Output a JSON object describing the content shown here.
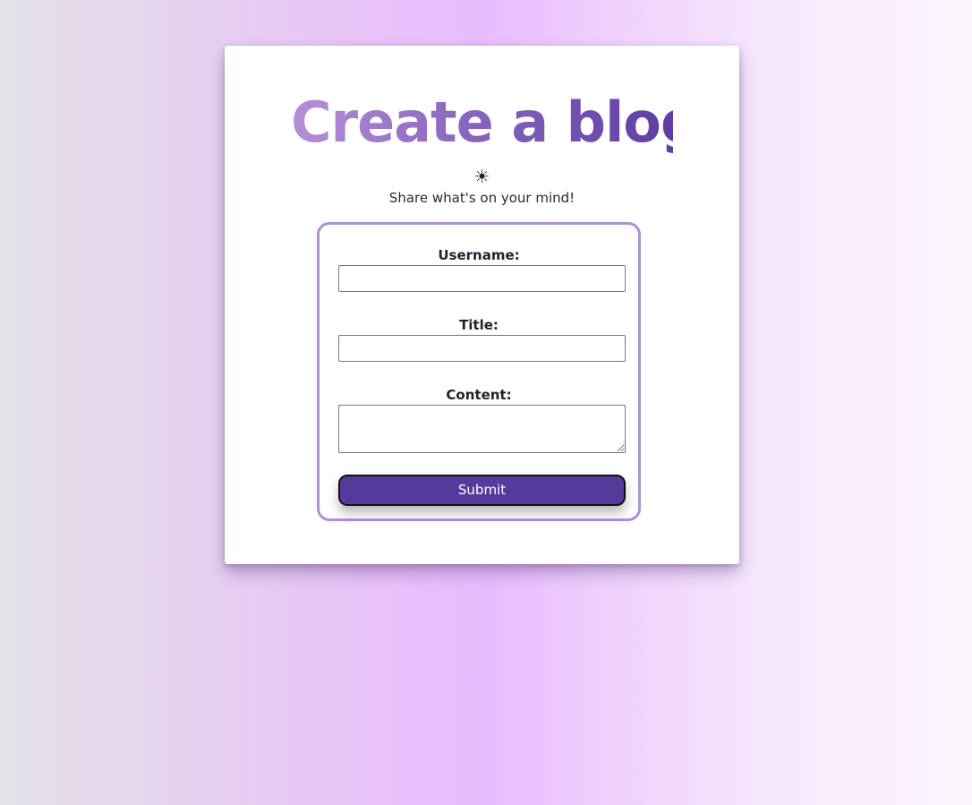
{
  "page": {
    "title": "Create a blog",
    "theme_toggle_icon": "sun-icon",
    "theme_toggle_glyph": "☀",
    "subtitle": "Share what's on your mind!"
  },
  "form": {
    "username_label": "Username:",
    "username_value": "",
    "title_label": "Title:",
    "title_value": "",
    "content_label": "Content:",
    "content_value": "",
    "submit_label": "Submit"
  },
  "colors": {
    "background_gradient": [
      "#e4e2e8",
      "#e8bcfd",
      "#fbf6fd"
    ],
    "title_gradient": [
      "#b68fd6",
      "#5f3ea3"
    ],
    "form_border": "#b08fd4",
    "submit_button": "#573b9c",
    "card": "#ffffff"
  }
}
